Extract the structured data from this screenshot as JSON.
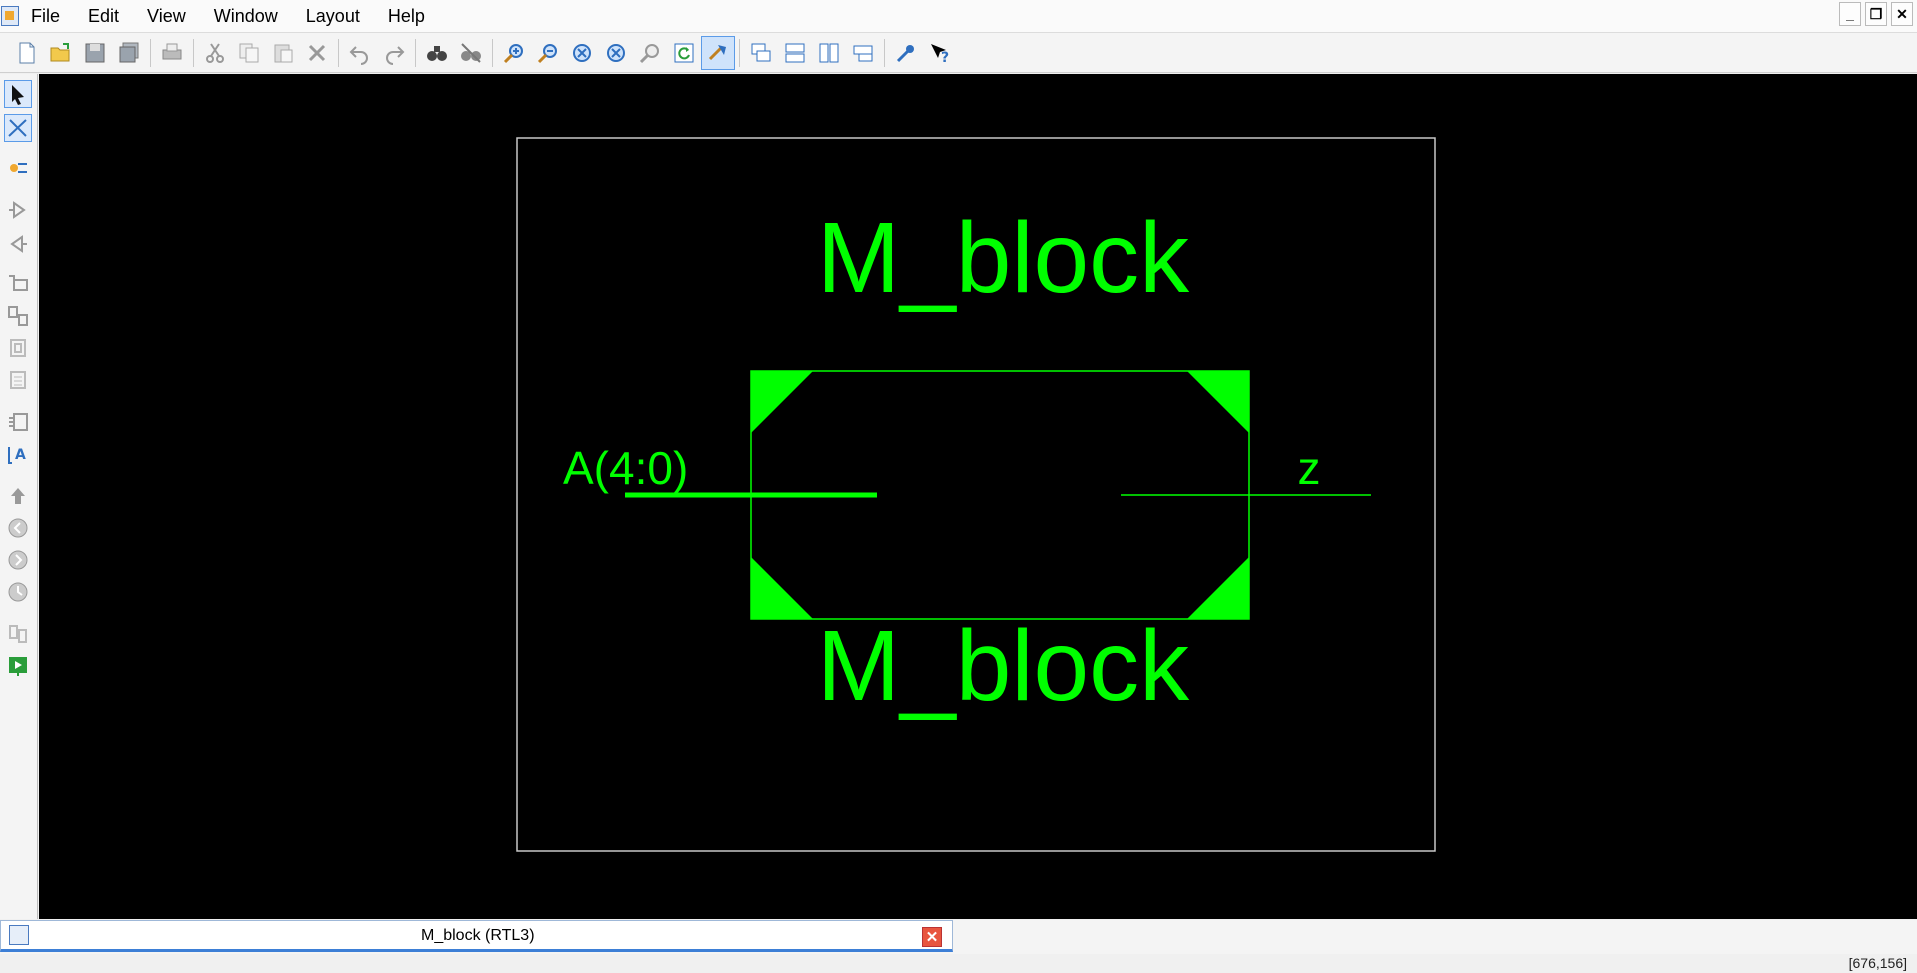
{
  "menu": [
    "File",
    "Edit",
    "View",
    "Window",
    "Layout",
    "Help"
  ],
  "window_controls": {
    "minimize": "_",
    "restore": "❐",
    "close": "✕"
  },
  "toolbar_icons": [
    "new-file-icon",
    "open-folder-icon",
    "save-icon",
    "save-all-icon",
    "print-icon",
    "cut-icon",
    "copy-icon",
    "paste-icon",
    "delete-icon",
    "undo-icon",
    "redo-icon",
    "find-icon",
    "find-next-icon",
    "zoom-in-icon",
    "zoom-out-icon",
    "zoom-full-icon",
    "zoom-fit-icon",
    "zoom-selection-icon",
    "refresh-icon",
    "pan-icon",
    "cascade-windows-icon",
    "tile-horizontal-icon",
    "tile-vertical-icon",
    "arrange-windows-icon",
    "options-wrench-icon",
    "help-icon"
  ],
  "palette_icons": [
    "select-arrow-icon",
    "add-wire-icon",
    "highlight-icon",
    "expand-input-icon",
    "expand-output-icon",
    "push-into-icon",
    "pop-out-icon",
    "hierarchy-icon",
    "properties-icon",
    "text-edit-icon",
    "add-text-icon",
    "go-up-icon",
    "back-icon",
    "forward-icon",
    "history-icon",
    "sheets-icon",
    "run-icon"
  ],
  "schematic": {
    "block_name_top": "M_block",
    "block_name_bottom": "M_block",
    "input_port": "A(4:0)",
    "output_port": "z",
    "color": "#00ff00",
    "frame_color": "#c8c8c8"
  },
  "document_tab": {
    "label": "M_block (RTL3)",
    "close": "✕"
  },
  "status": {
    "coords": "[676,156]"
  }
}
